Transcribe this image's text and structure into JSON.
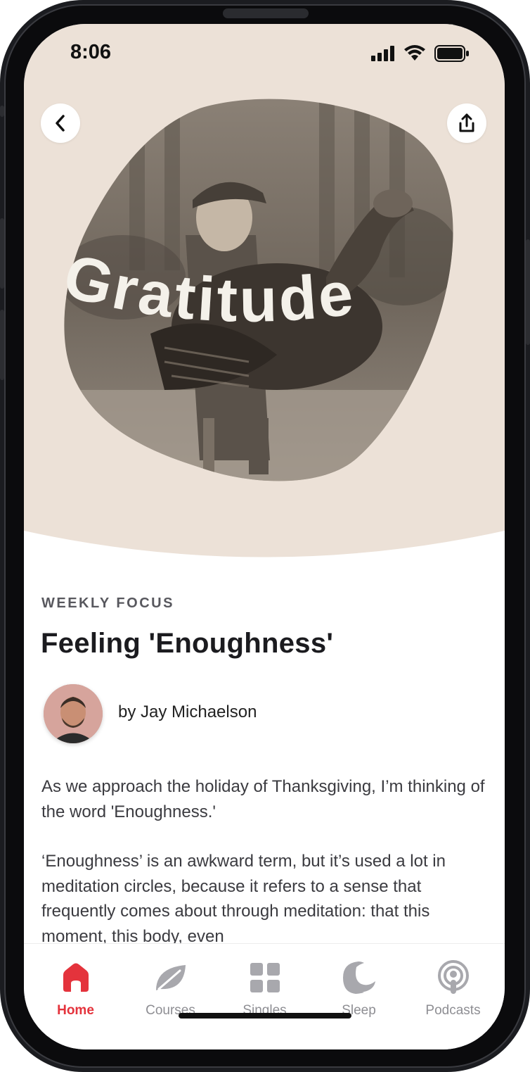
{
  "status": {
    "time": "8:06"
  },
  "hero": {
    "image_alt": "Vintage photo of a boy holding a turkey",
    "overlay_title": "Gratitude",
    "back_icon": "chevron-left-icon",
    "share_icon": "share-icon"
  },
  "article": {
    "eyebrow": "WEEKLY FOCUS",
    "title": "Feeling 'Enoughness'",
    "author": "by Jay Michaelson",
    "paragraphs": [
      "As we approach the holiday of Thanksgiving, I’m thinking of the word 'Enoughness.'",
      "‘Enoughness’ is an awkward term, but it’s used a lot in meditation circles, because it refers to a sense that frequently comes about through meditation: that this moment, this body, even"
    ]
  },
  "tabbar": {
    "active": "Home",
    "tabs": [
      {
        "label": "Home",
        "icon": "home-icon"
      },
      {
        "label": "Courses",
        "icon": "leaf-icon"
      },
      {
        "label": "Singles",
        "icon": "grid-icon"
      },
      {
        "label": "Sleep",
        "icon": "moon-icon"
      },
      {
        "label": "Podcasts",
        "icon": "podcast-icon"
      }
    ]
  },
  "colors": {
    "hero_bg": "#ece1d7",
    "accent": "#e4333c",
    "tab_inactive": "#8e8e93",
    "overlay_text": "#f4f1ea"
  }
}
